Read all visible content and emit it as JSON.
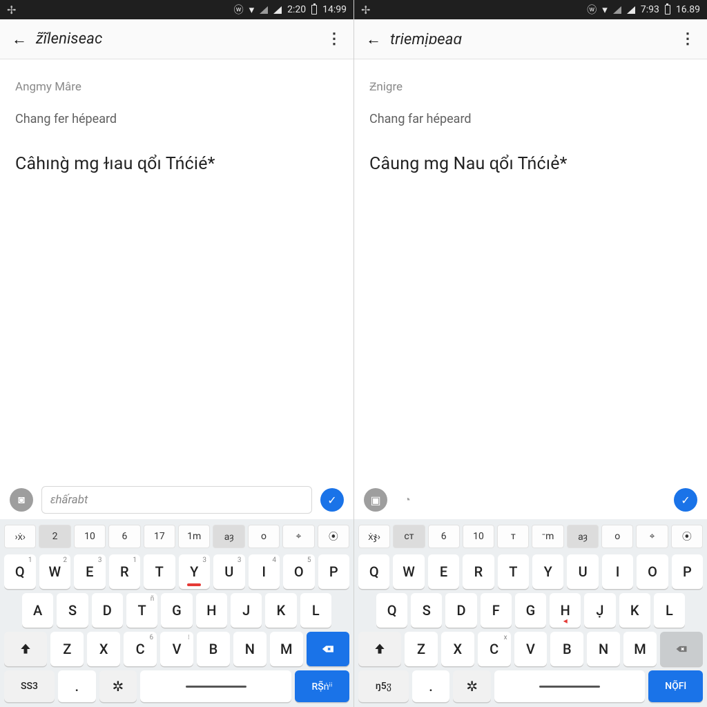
{
  "left": {
    "status": {
      "time": "2:20",
      "extra": "14:99",
      "dagger": "✢"
    },
    "appbar": {
      "title": "z̃ĩleniseac"
    },
    "content": {
      "meta1": "Angmy Mâre",
      "meta2": "Chang fer hépeard",
      "headline": "Câhıng̀ mg ɫıau ɋổı Tńćié*"
    },
    "input": {
      "placeholder": "ɛhấrabt"
    },
    "suggest": [
      "›ẋ›",
      "2",
      "10",
      "6",
      "17",
      "1m",
      "aȝ",
      "o",
      "⌖",
      "⦿"
    ],
    "rows": {
      "r1": [
        {
          "k": "Q",
          "s": "1"
        },
        {
          "k": "W",
          "s": "2"
        },
        {
          "k": "E",
          "s": "3"
        },
        {
          "k": "R",
          "s": "1"
        },
        {
          "k": "T",
          "s": ""
        },
        {
          "k": "Y",
          "s": "3",
          "red": true
        },
        {
          "k": "U",
          "s": "3"
        },
        {
          "k": "I",
          "s": "4"
        },
        {
          "k": "O",
          "s": "5"
        },
        {
          "k": "P",
          "s": ""
        }
      ],
      "r2": [
        {
          "k": "A",
          "s": ""
        },
        {
          "k": "S",
          "s": ""
        },
        {
          "k": "D",
          "s": ""
        },
        {
          "k": "T",
          "s": "ñ"
        },
        {
          "k": "G",
          "s": ""
        },
        {
          "k": "H",
          "s": ""
        },
        {
          "k": "J",
          "s": ""
        },
        {
          "k": "K",
          "s": ""
        },
        {
          "k": "L",
          "s": ""
        }
      ],
      "r3": [
        {
          "k": "Z",
          "s": ""
        },
        {
          "k": "X",
          "s": ""
        },
        {
          "k": "C",
          "s": "6"
        },
        {
          "k": "V",
          "s": "⁝"
        },
        {
          "k": "B",
          "s": ""
        },
        {
          "k": "N",
          "s": ""
        },
        {
          "k": "M",
          "s": ""
        }
      ],
      "r4": {
        "sym": "SS3",
        "punct": ".",
        "enter": "RṢ̃ṅⁱⁱ"
      }
    }
  },
  "right": {
    "status": {
      "time": "7:93",
      "extra": "16.89",
      "dagger": "✢"
    },
    "appbar": {
      "title": "triemịɒeaɑ"
    },
    "content": {
      "meta1": "Ƶnigre",
      "meta2": "Chang far hépeard",
      "headline": "Câung mg Nau ɋổı Tńćıẻ*"
    },
    "input": {
      "placeholder": ""
    },
    "suggest": [
      "ẋჯ›",
      "cт",
      "6",
      "10",
      "т",
      "⁻m",
      "aȝ",
      "o",
      "⌖",
      "⦿"
    ],
    "rows": {
      "r1": [
        {
          "k": "Q",
          "s": ""
        },
        {
          "k": "W",
          "s": ""
        },
        {
          "k": "E",
          "s": ""
        },
        {
          "k": "R",
          "s": ""
        },
        {
          "k": "T",
          "s": ""
        },
        {
          "k": "Y",
          "s": ""
        },
        {
          "k": "U",
          "s": ""
        },
        {
          "k": "I",
          "s": ""
        },
        {
          "k": "O",
          "s": ""
        },
        {
          "k": "P",
          "s": ""
        }
      ],
      "r2": [
        {
          "k": "Q",
          "s": ""
        },
        {
          "k": "S",
          "s": ""
        },
        {
          "k": "D",
          "s": ""
        },
        {
          "k": "F",
          "s": ""
        },
        {
          "k": "G",
          "s": ""
        },
        {
          "k": "H",
          "s": "",
          "redarrow": true
        },
        {
          "k": "J̣",
          "s": ""
        },
        {
          "k": "K",
          "s": ""
        },
        {
          "k": "L",
          "s": ""
        }
      ],
      "r3": [
        {
          "k": "Z",
          "s": ""
        },
        {
          "k": "X",
          "s": ""
        },
        {
          "k": "C",
          "s": "x"
        },
        {
          "k": "V",
          "s": ""
        },
        {
          "k": "B",
          "s": ""
        },
        {
          "k": "N",
          "s": ""
        },
        {
          "k": "M",
          "s": ""
        }
      ],
      "r4": {
        "sym": "ŋ5ჳ",
        "punct": ".",
        "enter": "NỌ̃Fl"
      }
    }
  }
}
